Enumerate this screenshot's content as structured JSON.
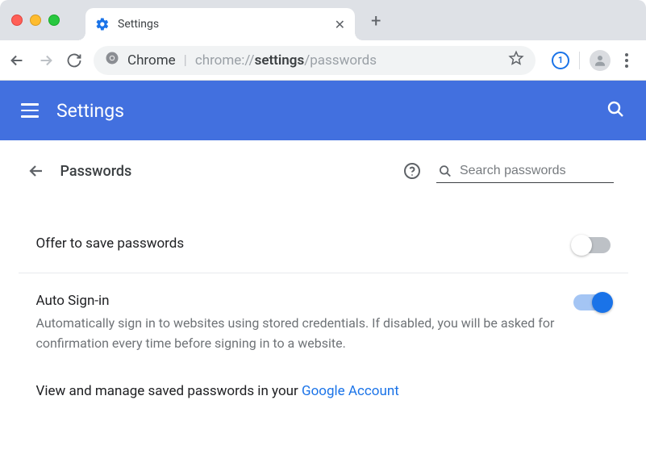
{
  "chrome": {
    "tab_title": "Settings",
    "omnibox_label": "Chrome",
    "url_prefix": "chrome://",
    "url_bold": "settings",
    "url_suffix": "/passwords",
    "extension_label": "1"
  },
  "header": {
    "title": "Settings"
  },
  "page": {
    "title": "Passwords",
    "search_placeholder": "Search passwords"
  },
  "sections": {
    "offer": {
      "title": "Offer to save passwords",
      "enabled": false
    },
    "autosignin": {
      "title": "Auto Sign-in",
      "desc": "Automatically sign in to websites using stored credentials. If disabled, you will be asked for confirmation every time before signing in to a website.",
      "enabled": true
    },
    "manage": {
      "prefix": "View and manage saved passwords in your ",
      "link": "Google Account"
    }
  }
}
